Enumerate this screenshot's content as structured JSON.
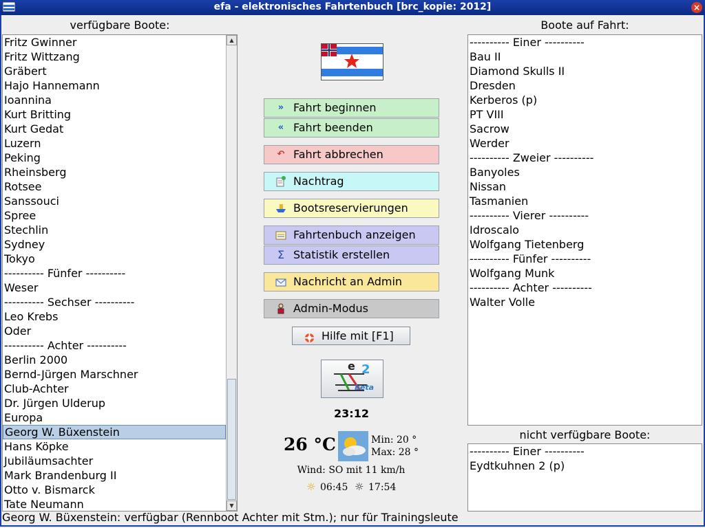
{
  "window": {
    "title": "efa - elektronisches Fahrtenbuch [brc_kopie: 2012]"
  },
  "available": {
    "heading": "verfügbare Boote:",
    "items": [
      "Fritz Gwinner",
      "Fritz Wittzang",
      "Gräbert",
      "Hajo Hannemann",
      "Ioannina",
      "Kurt Britting",
      "Kurt Gedat",
      "Luzern",
      "Peking",
      "Rheinsberg",
      "Rotsee",
      "Sanssouci",
      "Spree",
      "Stechlin",
      "Sydney",
      "Tokyo",
      "---------- Fünfer ----------",
      "Weser",
      "---------- Sechser ----------",
      "Leo Krebs",
      "Oder",
      "---------- Achter ----------",
      "Berlin 2000",
      "Bernd-Jürgen Marschner",
      "Club-Achter",
      "Dr. Jürgen Ulderup",
      "Europa",
      "Georg W. Büxenstein",
      "Hans Köpke",
      "Jubiläumsachter",
      "Mark Brandenburg II",
      "Otto v. Bismarck",
      "Tate Neumann"
    ],
    "selected": "Georg W. Büxenstein"
  },
  "onTrip": {
    "heading": "Boote auf Fahrt:",
    "items": [
      "---------- Einer ----------",
      "Bau II",
      "Diamond Skulls II",
      "Dresden",
      "Kerberos (p)",
      "PT VIII",
      "Sacrow",
      "Werder",
      "---------- Zweier ----------",
      "Banyoles",
      "Nissan",
      "Tasmanien",
      "---------- Vierer ----------",
      "Idroscalo",
      "Wolfgang Tietenberg",
      "---------- Fünfer ----------",
      "Wolfgang Munk",
      "---------- Achter ----------",
      "Walter Volle"
    ]
  },
  "unavailable": {
    "heading": "nicht verfügbare Boote:",
    "items": [
      "---------- Einer ----------",
      "Eydtkuhnen 2 (p)"
    ]
  },
  "actions": {
    "start": "Fahrt beginnen",
    "end": "Fahrt beenden",
    "abort": "Fahrt abbrechen",
    "late_entry": "Nachtrag",
    "reservations": "Bootsreservierungen",
    "show_logbook": "Fahrtenbuch anzeigen",
    "statistics": "Statistik erstellen",
    "message_admin": "Nachricht an Admin",
    "admin_mode": "Admin-Modus",
    "help": "Hilfe mit [F1]"
  },
  "info": {
    "time": "23:12",
    "temperature": "26 °C",
    "min": "Min: 20 °",
    "max": "Max: 28 °",
    "wind": "Wind: SO mit 11 km/h",
    "sunrise": "06:45",
    "sunset": "17:54"
  },
  "logo": {
    "text_e": "e",
    "text_2": "2",
    "text_beta": "beta"
  },
  "status": "Georg W. Büxenstein: verfügbar (Rennboot Achter mit Stm.); nur für Trainingsleute",
  "colors": {
    "title_bar": "#0b2a85",
    "start_btn": "#c8f0c8",
    "abort_btn": "#f7c8c8",
    "late_btn": "#c8f7f7",
    "reserve_btn": "#fafac0",
    "logbook_btn": "#c8c8f2",
    "message_btn": "#fae79a",
    "admin_btn": "#c8c8c8",
    "selection": "#b8cfe5"
  }
}
